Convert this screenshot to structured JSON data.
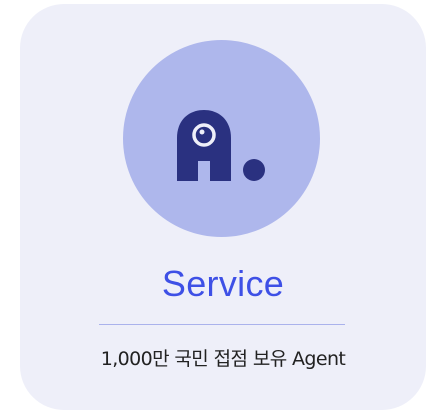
{
  "card": {
    "title": "Service",
    "description": "1,000만 국민 접점 보유 Agent",
    "logo_icon": "agent-logo-icon",
    "colors": {
      "card_background": "#eeeff9",
      "logo_circle": "#aeb7ec",
      "logo_mark": "#2a3180",
      "title": "#3e50e6",
      "divider": "#aab2ec"
    }
  }
}
